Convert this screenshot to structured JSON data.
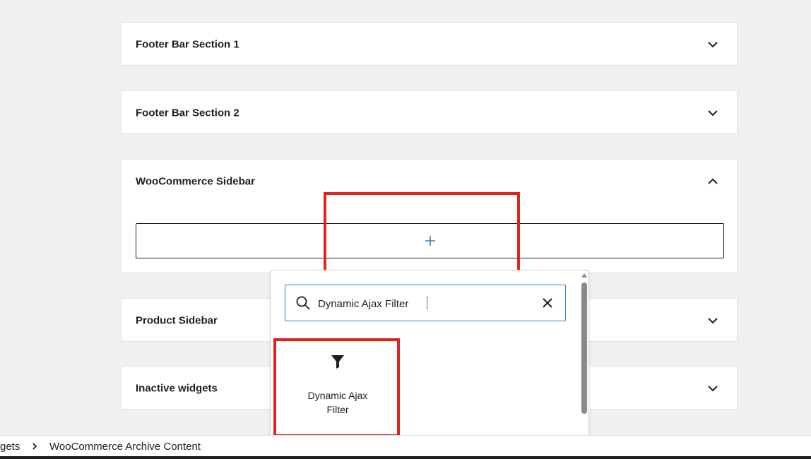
{
  "panels": [
    {
      "title": "Footer Bar Section 1",
      "expanded": false
    },
    {
      "title": "Footer Bar Section 2",
      "expanded": false
    },
    {
      "title": "WooCommerce Sidebar",
      "expanded": true
    },
    {
      "title": "Product Sidebar",
      "expanded": false
    },
    {
      "title": "Inactive widgets",
      "expanded": false
    }
  ],
  "inserter": {
    "search_value": "Dynamic Ajax Filter",
    "result": {
      "label": "Dynamic Ajax Filter",
      "icon": "filter-icon"
    }
  },
  "breadcrumb": {
    "items": [
      "gets",
      "WooCommerce Archive Content"
    ]
  },
  "colors": {
    "accent": "#3582c4",
    "highlight": "#e2221c",
    "plus": "#3582c4",
    "text": "#1e1e1e"
  }
}
